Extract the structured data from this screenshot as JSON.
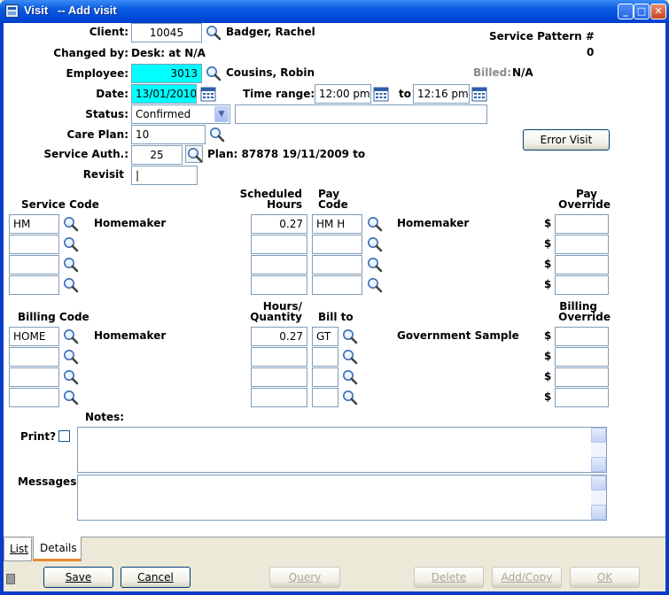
{
  "window": {
    "title": "Visit   -- Add visit",
    "min": "_",
    "max": "□",
    "close": "✕"
  },
  "client": {
    "label": "Client:",
    "id": "10045",
    "name": "Badger, Rachel"
  },
  "service_pattern": {
    "label": "Service Pattern #",
    "value": "0"
  },
  "changed_by": {
    "label": "Changed by:",
    "value": "Desk: at N/A"
  },
  "employee": {
    "label": "Employee:",
    "id": "3013",
    "name": "Cousins, Robin"
  },
  "billed": {
    "label": "Billed:",
    "value": "N/A"
  },
  "date": {
    "label": "Date:",
    "value": "13/01/2010"
  },
  "time_range": {
    "label": "Time range:",
    "from": "12:00 pm",
    "to_label": "to",
    "to": "12:16 pm"
  },
  "status": {
    "label": "Status:",
    "value": "Confirmed",
    "note": ""
  },
  "care_plan": {
    "label": "Care Plan:",
    "value": "10"
  },
  "service_auth": {
    "label": "Service Auth.:",
    "value": "25",
    "plan": "Plan: 87878 19/11/2009 to"
  },
  "revisit": {
    "label": "Revisit",
    "value": "|"
  },
  "error_visit": "Error Visit",
  "service": {
    "code_header": "Service Code",
    "sched_header_1": "Scheduled",
    "sched_header_2": "Hours",
    "pay_header_1": "Pay",
    "pay_header_2": "Code",
    "override_header_1": "Pay",
    "override_header_2": "Override",
    "currency": "$",
    "rows": [
      {
        "code": "HM",
        "desc": "Homemaker",
        "hours": "0.27",
        "pay_code": "HM  H",
        "pay_desc": "Homemaker",
        "override": ""
      },
      {
        "code": "",
        "desc": "",
        "hours": "",
        "pay_code": "",
        "pay_desc": "",
        "override": ""
      },
      {
        "code": "",
        "desc": "",
        "hours": "",
        "pay_code": "",
        "pay_desc": "",
        "override": ""
      },
      {
        "code": "",
        "desc": "",
        "hours": "",
        "pay_code": "",
        "pay_desc": "",
        "override": ""
      }
    ]
  },
  "billing": {
    "code_header": "Billing Code",
    "hours_header_1": "Hours/",
    "hours_header_2": "Quantity",
    "billto_header": "Bill to",
    "override_header_1": "Billing",
    "override_header_2": "Override",
    "currency": "$",
    "rows": [
      {
        "code": "HOME",
        "desc": "Homemaker",
        "qty": "0.27",
        "bill_to": "GT",
        "bill_desc": "Government Sample",
        "override": ""
      },
      {
        "code": "",
        "desc": "",
        "qty": "",
        "bill_to": "",
        "bill_desc": "",
        "override": ""
      },
      {
        "code": "",
        "desc": "",
        "qty": "",
        "bill_to": "",
        "bill_desc": "",
        "override": ""
      },
      {
        "code": "",
        "desc": "",
        "qty": "",
        "bill_to": "",
        "bill_desc": "",
        "override": ""
      }
    ]
  },
  "notes": {
    "label": "Notes:",
    "print_label": "Print?",
    "value": ""
  },
  "messages": {
    "label": "Messages:",
    "value": ""
  },
  "tabs": [
    {
      "label": "List"
    },
    {
      "label": "Details"
    }
  ],
  "buttons": {
    "save": "Save",
    "cancel": "Cancel",
    "query": "Query",
    "delete": "Delete",
    "addcopy": "Add/Copy",
    "ok": "OK"
  }
}
